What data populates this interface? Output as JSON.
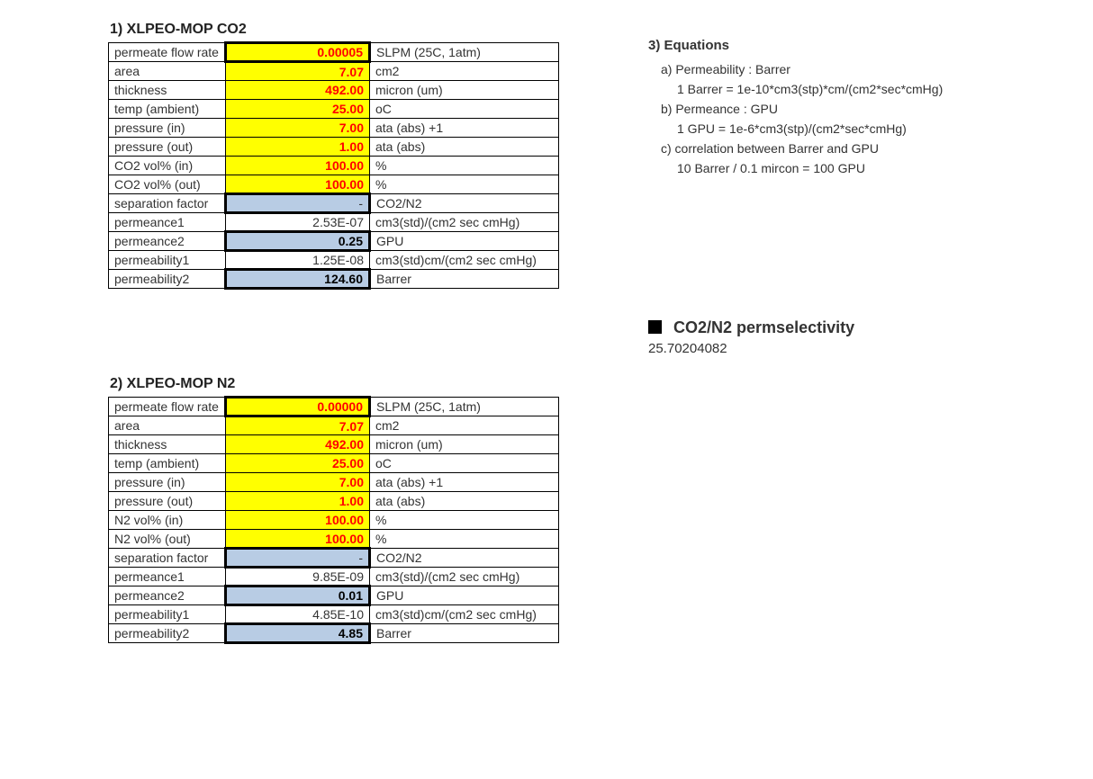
{
  "sections": {
    "co2": {
      "title": "1) XLPEO-MOP CO2",
      "rows": [
        {
          "label": "permeate flow rate",
          "value": "0.00005",
          "unit": "SLPM (25C, 1atm)",
          "cls": "yellow thick-border",
          "vcls": "bold-red"
        },
        {
          "label": "area",
          "value": "7.07",
          "unit": "cm2",
          "cls": "yellow",
          "vcls": "bold-red"
        },
        {
          "label": "thickness",
          "value": "492.00",
          "unit": "micron (um)",
          "cls": "yellow",
          "vcls": "bold-red"
        },
        {
          "label": "temp (ambient)",
          "value": "25.00",
          "unit": "oC",
          "cls": "yellow",
          "vcls": "bold-red"
        },
        {
          "label": "pressure (in)",
          "value": "7.00",
          "unit": "ata (abs) +1",
          "cls": "yellow",
          "vcls": "bold-red"
        },
        {
          "label": "pressure (out)",
          "value": "1.00",
          "unit": "ata (abs)",
          "cls": "yellow",
          "vcls": "bold-red"
        },
        {
          "label": "CO2 vol% (in)",
          "value": "100.00",
          "unit": "%",
          "cls": "yellow",
          "vcls": "bold-red"
        },
        {
          "label": "CO2 vol% (out)",
          "value": "100.00",
          "unit": "%",
          "cls": "yellow",
          "vcls": "bold-red"
        },
        {
          "label": "separation factor",
          "value": "-",
          "unit": "CO2/N2",
          "cls": "blue thick-border",
          "vcls": ""
        },
        {
          "label": "permeance1",
          "value": "2.53E-07",
          "unit": "cm3(std)/(cm2 sec cmHg)",
          "cls": "",
          "vcls": ""
        },
        {
          "label": "permeance2",
          "value": "0.25",
          "unit": "GPU",
          "cls": "blue thick-border",
          "vcls": "bold-blk"
        },
        {
          "label": "permeability1",
          "value": "1.25E-08",
          "unit": "cm3(std)cm/(cm2 sec cmHg)",
          "cls": "",
          "vcls": ""
        },
        {
          "label": "permeability2",
          "value": "124.60",
          "unit": "Barrer",
          "cls": "blue thick-border",
          "vcls": "bold-blk"
        }
      ]
    },
    "n2": {
      "title": "2) XLPEO-MOP N2",
      "rows": [
        {
          "label": "permeate flow rate",
          "value": "0.00000",
          "unit": "SLPM (25C, 1atm)",
          "cls": "yellow thick-border",
          "vcls": "bold-red"
        },
        {
          "label": "area",
          "value": "7.07",
          "unit": "cm2",
          "cls": "yellow",
          "vcls": "bold-red"
        },
        {
          "label": "thickness",
          "value": "492.00",
          "unit": "micron (um)",
          "cls": "yellow",
          "vcls": "bold-red"
        },
        {
          "label": "temp (ambient)",
          "value": "25.00",
          "unit": "oC",
          "cls": "yellow",
          "vcls": "bold-red"
        },
        {
          "label": "pressure (in)",
          "value": "7.00",
          "unit": "ata (abs) +1",
          "cls": "yellow",
          "vcls": "bold-red"
        },
        {
          "label": "pressure (out)",
          "value": "1.00",
          "unit": "ata (abs)",
          "cls": "yellow",
          "vcls": "bold-red"
        },
        {
          "label": "N2 vol% (in)",
          "value": "100.00",
          "unit": "%",
          "cls": "yellow",
          "vcls": "bold-red"
        },
        {
          "label": "N2 vol% (out)",
          "value": "100.00",
          "unit": "%",
          "cls": "yellow",
          "vcls": "bold-red"
        },
        {
          "label": "separation factor",
          "value": "-",
          "unit": "CO2/N2",
          "cls": "blue thick-border",
          "vcls": ""
        },
        {
          "label": "permeance1",
          "value": "9.85E-09",
          "unit": "cm3(std)/(cm2 sec cmHg)",
          "cls": "",
          "vcls": ""
        },
        {
          "label": "permeance2",
          "value": "0.01",
          "unit": "GPU",
          "cls": "blue thick-border",
          "vcls": "bold-blk"
        },
        {
          "label": "permeability1",
          "value": "4.85E-10",
          "unit": "cm3(std)cm/(cm2 sec cmHg)",
          "cls": "",
          "vcls": ""
        },
        {
          "label": "permeability2",
          "value": "4.85",
          "unit": "Barrer",
          "cls": "blue thick-border",
          "vcls": "bold-blk"
        }
      ]
    }
  },
  "equations": {
    "title": "3) Equations",
    "lines": [
      {
        "text": "a) Permeability : Barrer",
        "indent": 1
      },
      {
        "text": "1 Barrer = 1e-10*cm3(stp)*cm/(cm2*sec*cmHg)",
        "indent": 2
      },
      {
        "text": "b) Permeance : GPU",
        "indent": 1
      },
      {
        "text": "1 GPU = 1e-6*cm3(stp)/(cm2*sec*cmHg)",
        "indent": 2
      },
      {
        "text": "c) correlation between Barrer and GPU",
        "indent": 1
      },
      {
        "text": "10 Barrer / 0.1 mircon = 100 GPU",
        "indent": 2
      }
    ]
  },
  "permselectivity": {
    "title": "CO2/N2 permselectivity",
    "value": "25.70204082"
  }
}
